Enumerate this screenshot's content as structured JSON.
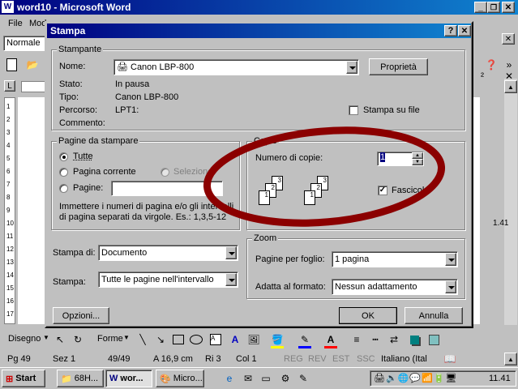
{
  "app": {
    "title": "word10 - Microsoft Word",
    "menu_file": "File",
    "menu_mod": "Mod",
    "style_value": "Normale"
  },
  "dialog": {
    "title": "Stampa",
    "help_btn": "?",
    "close_btn": "✕",
    "printer": {
      "group_label": "Stampante",
      "name_label": "Nome:",
      "name_value": "Canon LBP-800",
      "properties_btn": "Proprietà",
      "status_label": "Stato:",
      "status_value": "In pausa",
      "type_label": "Tipo:",
      "type_value": "Canon LBP-800",
      "path_label": "Percorso:",
      "path_value": "LPT1:",
      "comment_label": "Commento:",
      "print_to_file": "Stampa su file"
    },
    "pages": {
      "group_label": "Pagine da stampare",
      "all": "Tutte",
      "current": "Pagina corrente",
      "selection": "Selezione",
      "pages": "Pagine:",
      "hint": "Immettere i numeri di pagina e/o gli intervalli di pagina separati da virgole. Es.: 1,3,5-12"
    },
    "copies": {
      "group_label": "Copie",
      "count_label": "Numero di copie:",
      "count_value": "1",
      "collate": "Fascicola",
      "collate_checked": true
    },
    "print_what_label": "Stampa di:",
    "print_what_value": "Documento",
    "print_label": "Stampa:",
    "print_value": "Tutte le pagine nell'intervallo",
    "zoom": {
      "group_label": "Zoom",
      "pages_per_sheet_label": "Pagine per foglio:",
      "pages_per_sheet_value": "1 pagina",
      "scale_label": "Adatta al formato:",
      "scale_value": "Nessun adattamento"
    },
    "options_btn": "Opzioni...",
    "ok_btn": "OK",
    "cancel_btn": "Annulla",
    "annotation_color": "#8b0000"
  },
  "drawing_toolbar": {
    "draw": "Disegno",
    "shapes": "Forme"
  },
  "statusbar": {
    "page": "Pg 49",
    "section": "Sez 1",
    "pages": "49/49",
    "position": "A  16,9 cm",
    "line": "Ri 3",
    "col": "Col 1",
    "rec": "REG",
    "rev": "REV",
    "ext": "EST",
    "ovr": "SSC",
    "lang": "Italiano (Ital"
  },
  "taskbar": {
    "start": "Start",
    "tasks": [
      "68H...",
      "wor...",
      "Micro..."
    ],
    "clock": "11.41"
  },
  "ruler_numbers": [
    "1",
    "2",
    "3",
    "4",
    "5",
    "6",
    "7",
    "8",
    "9",
    "10",
    "11",
    "12",
    "13",
    "14",
    "15",
    "16",
    "17"
  ],
  "right_zoom": "1.41"
}
